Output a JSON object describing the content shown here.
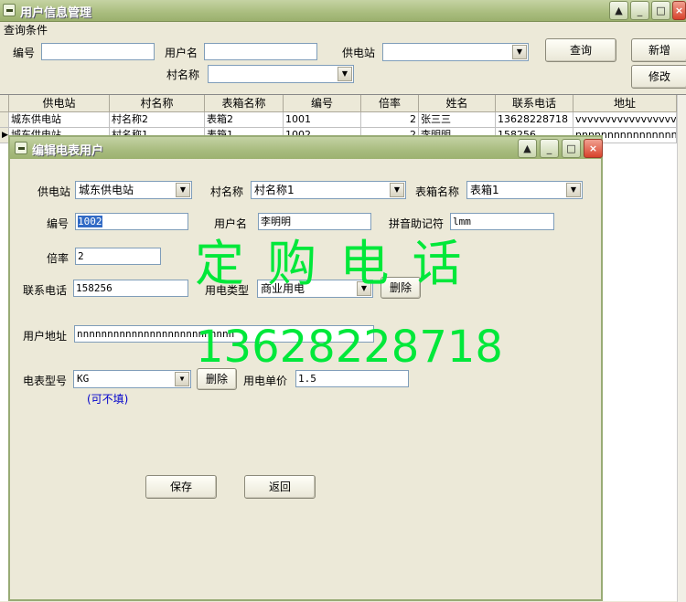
{
  "window": {
    "title": "用户信息管理"
  },
  "query": {
    "section_label": "查询条件",
    "code_label": "编号",
    "username_label": "用户名",
    "station_label": "供电站",
    "village_label": "村名称",
    "search_btn": "查询",
    "add_btn": "新增",
    "edit_btn": "修改"
  },
  "grid": {
    "headers": [
      "供电站",
      "村名称",
      "表箱名称",
      "编号",
      "倍率",
      "姓名",
      "联系电话",
      "地址"
    ],
    "rows": [
      [
        "城东供电站",
        "村名称2",
        "表箱2",
        "1001",
        "2",
        "张三三",
        "13628228718",
        "vvvvvvvvvvvvvvvvv"
      ],
      [
        "城东供电站",
        "村名称1",
        "表箱1",
        "1002",
        "2",
        "李明明",
        "158256",
        "nnnnnnnnnnnnnnnnn"
      ]
    ]
  },
  "dialog": {
    "title": "编辑电表用户",
    "station_label": "供电站",
    "station_value": "城东供电站",
    "village_label": "村名称",
    "village_value": "村名称1",
    "box_label": "表箱名称",
    "box_value": "表箱1",
    "code_label": "编号",
    "code_value": "1002",
    "username_label": "用户名",
    "username_value": "李明明",
    "pinyin_label": "拼音助记符",
    "pinyin_value": "lmm",
    "ratio_label": "倍率",
    "ratio_value": "2",
    "phone_label": "联系电话",
    "phone_value": "158256",
    "elec_type_label": "用电类型",
    "elec_type_value": "商业用电",
    "delete_btn": "删除",
    "address_label": "用户地址",
    "address_value": "nnnnnnnnnnnnnnnnnnnnnnnnnn",
    "meter_model_label": "电表型号",
    "meter_model_value": "KG",
    "meter_delete_btn": "删除",
    "unit_price_label": "用电单价",
    "unit_price_value": "1.5",
    "optional_hint": "(可不填)",
    "save_btn": "保存",
    "back_btn": "返回"
  },
  "watermark": {
    "line1": "定 购 电 话",
    "line2": "13628228718"
  },
  "colors": {
    "titlebar": "#a9bd7e",
    "watermark": "#00e83a",
    "selection": "#316ac5"
  }
}
